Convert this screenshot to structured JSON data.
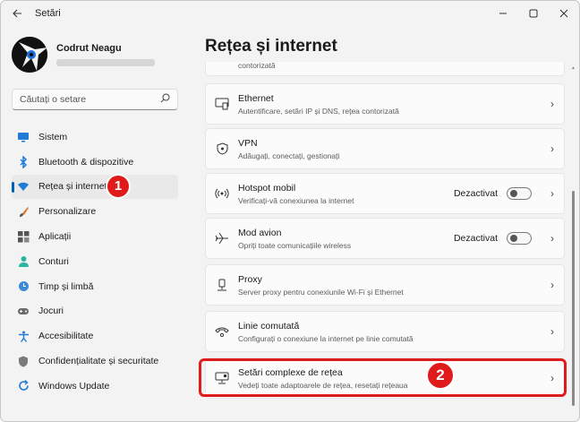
{
  "window": {
    "title": "Setări"
  },
  "profile": {
    "name": "Codrut Neagu"
  },
  "search": {
    "placeholder": "Căutați o setare"
  },
  "nav": {
    "items": [
      {
        "label": "Sistem",
        "icon": "monitor-icon"
      },
      {
        "label": "Bluetooth & dispozitive",
        "icon": "bluetooth-icon"
      },
      {
        "label": "Rețea și internet",
        "icon": "wifi-icon",
        "active": true
      },
      {
        "label": "Personalizare",
        "icon": "brush-icon"
      },
      {
        "label": "Aplicații",
        "icon": "apps-icon"
      },
      {
        "label": "Conturi",
        "icon": "person-icon"
      },
      {
        "label": "Timp și limbă",
        "icon": "globe-clock-icon"
      },
      {
        "label": "Jocuri",
        "icon": "gamepad-icon"
      },
      {
        "label": "Accesibilitate",
        "icon": "accessibility-icon"
      },
      {
        "label": "Confidențialitate și securitate",
        "icon": "shield-icon"
      },
      {
        "label": "Windows Update",
        "icon": "update-icon"
      }
    ]
  },
  "main": {
    "heading": "Rețea și internet",
    "partial_text": "contorizată",
    "cards": [
      {
        "title": "Ethernet",
        "subtitle": "Autentificare, setări IP și DNS, rețea contorizată",
        "icon": "ethernet-icon"
      },
      {
        "title": "VPN",
        "subtitle": "Adăugați, conectați, gestionați",
        "icon": "vpn-shield-icon"
      },
      {
        "title": "Hotspot mobil",
        "subtitle": "Verificați-vă conexiunea la internet",
        "icon": "hotspot-icon",
        "status": "Dezactivat",
        "toggle": false
      },
      {
        "title": "Mod avion",
        "subtitle": "Opriți toate comunicațiile wireless",
        "icon": "airplane-icon",
        "status": "Dezactivat",
        "toggle": false
      },
      {
        "title": "Proxy",
        "subtitle": "Server proxy pentru conexiunile Wi-Fi și Ethernet",
        "icon": "proxy-icon"
      },
      {
        "title": "Linie comutată",
        "subtitle": "Configurați o conexiune la internet pe linie comutată",
        "icon": "dialup-icon"
      },
      {
        "title": "Setări complexe de rețea",
        "subtitle": "Vedeți toate adaptoarele de rețea, resetați rețeaua",
        "icon": "network-pc-icon",
        "highlighted": true
      }
    ]
  },
  "annotations": {
    "badge1": "1",
    "badge2": "2",
    "color": "#e01b1b"
  },
  "colors": {
    "accent": "#005fb8",
    "background": "#f3f3f3",
    "card": "#fbfbfb"
  }
}
